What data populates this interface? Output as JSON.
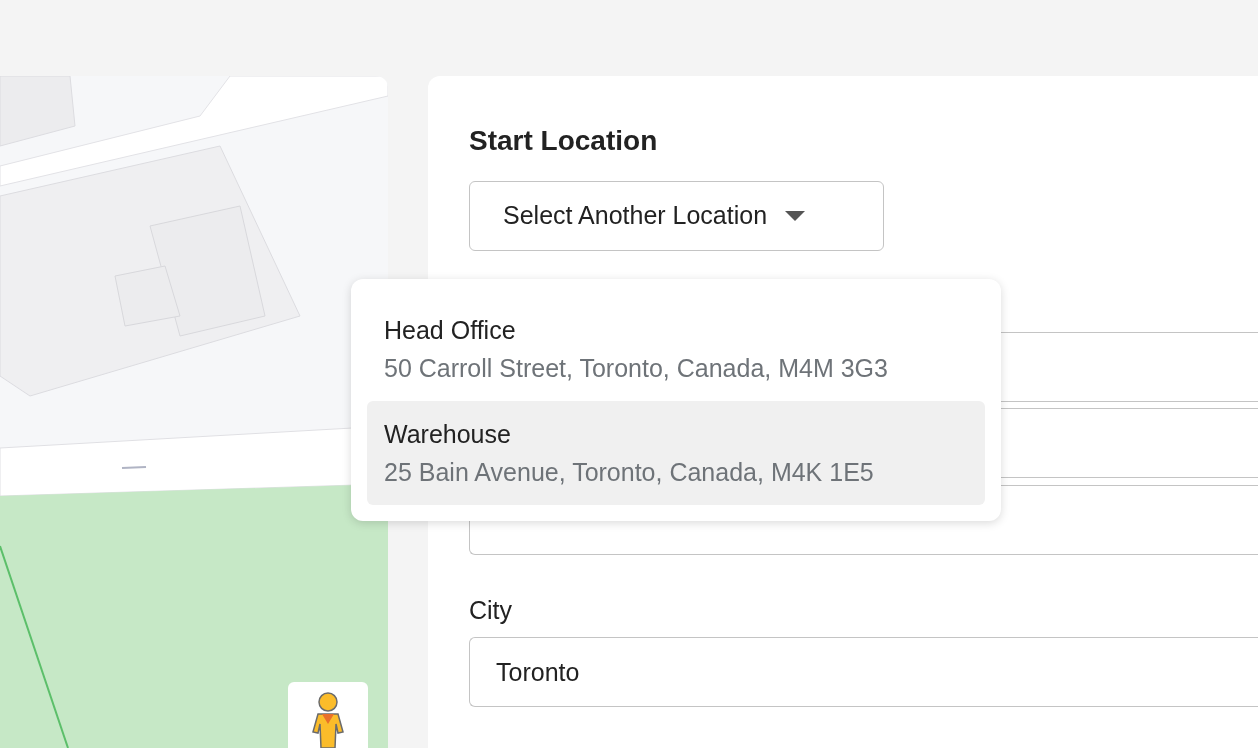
{
  "start_location": {
    "title": "Start Location",
    "select_button": "Select Another Location",
    "options": [
      {
        "name": "Head Office",
        "address": "50 Carroll Street, Toronto, Canada, M4M 3G3",
        "selected": false
      },
      {
        "name": "Warehouse",
        "address": "25 Bain Avenue, Toronto, Canada, M4K 1E5",
        "selected": true
      }
    ],
    "city": {
      "label": "City",
      "value": "Toronto"
    }
  }
}
